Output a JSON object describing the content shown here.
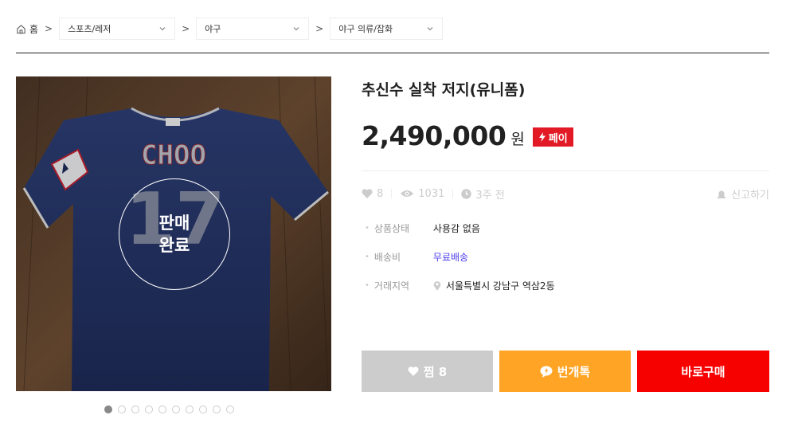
{
  "breadcrumb": {
    "home_label": "홈",
    "categories": [
      "스포츠/레저",
      "야구",
      "야구 의류/잡화"
    ]
  },
  "product": {
    "title": "추신수 실착 저지(유니폼)",
    "price": "2,490,000",
    "currency": "원",
    "pay_badge": "페이",
    "sold_overlay": "판매\n완료",
    "jersey_name": "CHOO",
    "jersey_number": "17",
    "image_count": 10,
    "active_image": 0
  },
  "stats": {
    "likes": "8",
    "views": "1031",
    "time_ago": "3주 전",
    "report_label": "신고하기"
  },
  "meta": {
    "condition_label": "상품상태",
    "condition_value": "사용감 없음",
    "shipping_label": "배송비",
    "shipping_value": "무료배송",
    "region_label": "거래지역",
    "region_value": "서울특별시 강남구 역삼2동"
  },
  "actions": {
    "wish_label": "찜 8",
    "talk_label": "번개톡",
    "buy_label": "바로구매"
  },
  "colors": {
    "pay_red": "#e21a25",
    "talk_orange": "#ffa424",
    "buy_red": "#f70000",
    "wish_gray": "#cccccc",
    "link_purple": "#4c3dea"
  }
}
